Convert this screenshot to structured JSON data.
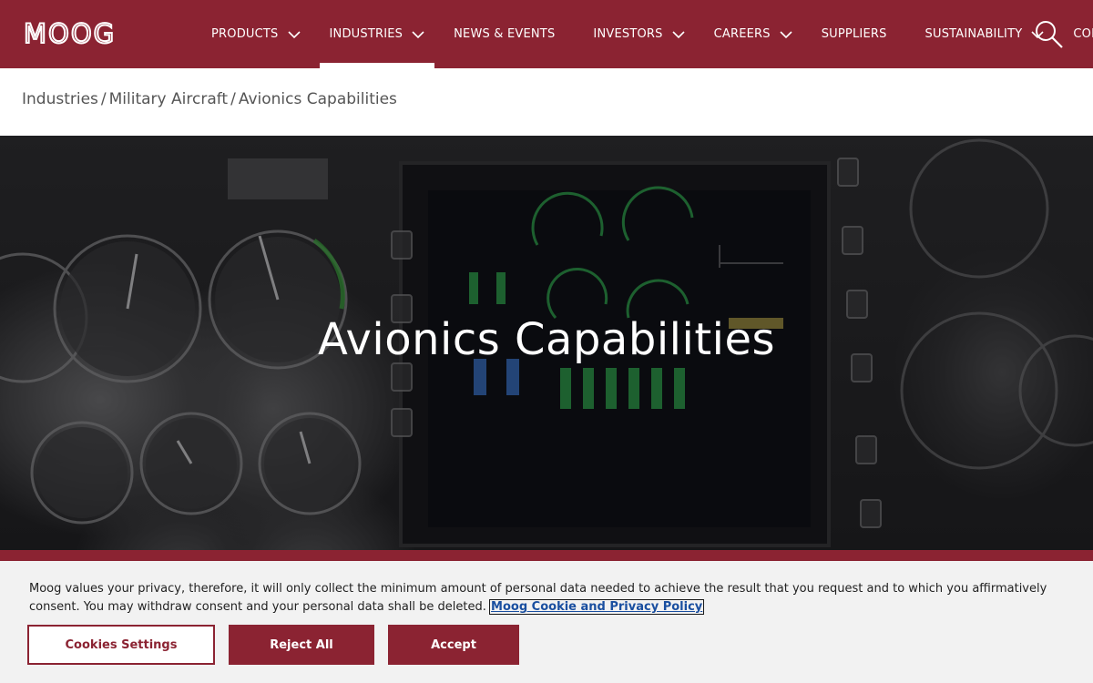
{
  "brand": {
    "logo_text": "MOOG",
    "primary_color": "#8b2332"
  },
  "nav": {
    "items": [
      {
        "label": "PRODUCTS",
        "has_dropdown": true
      },
      {
        "label": "INDUSTRIES",
        "has_dropdown": true,
        "active": true
      },
      {
        "label": "NEWS & EVENTS",
        "has_dropdown": false
      },
      {
        "label": "INVESTORS",
        "has_dropdown": true
      },
      {
        "label": "CAREERS",
        "has_dropdown": true
      },
      {
        "label": "SUPPLIERS",
        "has_dropdown": false
      },
      {
        "label": "SUSTAINABILITY",
        "has_dropdown": true
      },
      {
        "label": "CONTACT",
        "has_dropdown": false
      }
    ],
    "search_icon": "search-icon"
  },
  "breadcrumb": {
    "items": [
      "Industries",
      "Military Aircraft",
      "Avionics Capabilities"
    ],
    "separator": "/"
  },
  "hero": {
    "title": "Avionics Capabilities"
  },
  "cookie_banner": {
    "text": "Moog values your privacy, therefore, it will only collect the minimum amount of personal data needed to achieve the result that you request and to which you affirmatively consent. You may withdraw consent and your personal data shall be deleted.",
    "link_text": "Moog Cookie and Privacy Policy",
    "buttons": {
      "settings": "Cookies Settings",
      "reject": "Reject All",
      "accept": "Accept"
    }
  }
}
